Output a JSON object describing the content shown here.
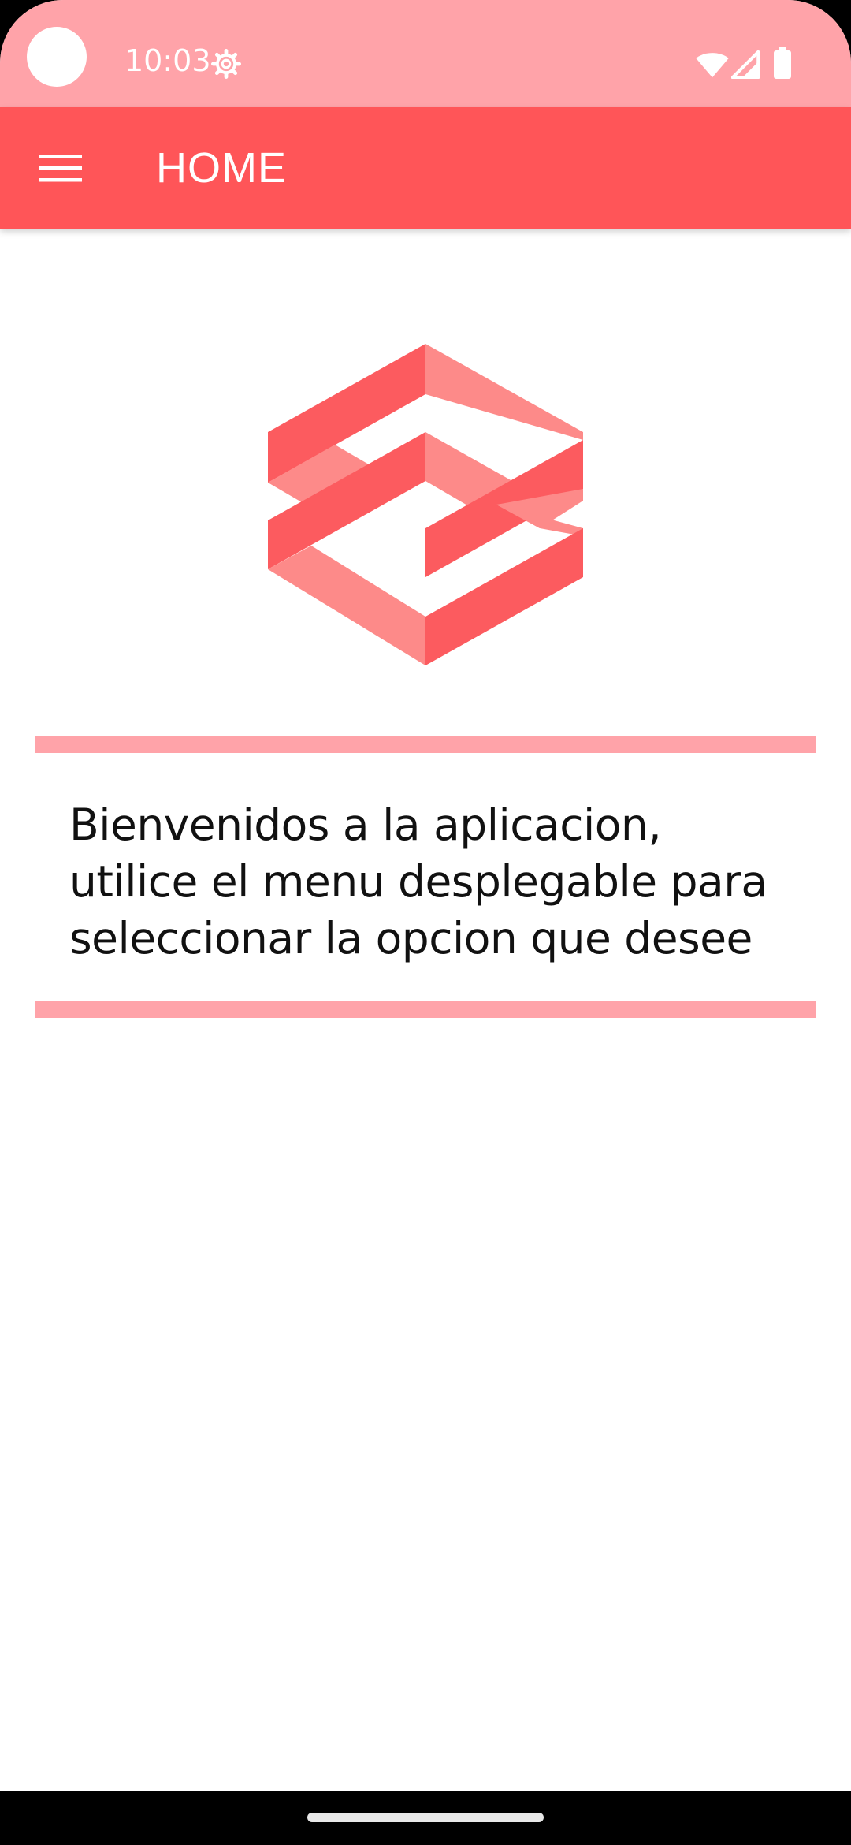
{
  "status_bar": {
    "time": "10:03",
    "icons": [
      "settings-icon",
      "wifi-icon",
      "cell-signal-icon",
      "battery-icon"
    ]
  },
  "app_bar": {
    "title": "HOME",
    "menu_icon": "hamburger-menu-icon",
    "background_color": "#ff5558"
  },
  "main": {
    "logo": "hexagon-logo",
    "welcome_text": "Bienvenidos a la aplicacion, utilice el menu desplegable para seleccionar la opcion que desee",
    "divider_color": "#ffa3a9"
  },
  "colors": {
    "status_bar": "#ffa3a9",
    "accent": "#ff5558",
    "logo_dark": "#fc5b5f",
    "logo_light": "#fd8a89"
  }
}
